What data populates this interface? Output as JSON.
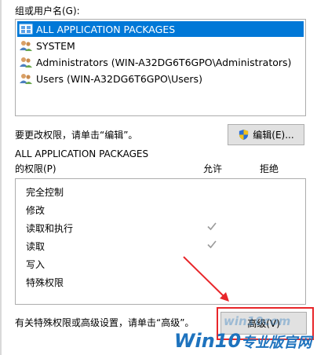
{
  "groups_label": "组或用户名(G):",
  "users": [
    {
      "label": "ALL APPLICATION PACKAGES",
      "icon": "app-packages-icon",
      "selected": true
    },
    {
      "label": "SYSTEM",
      "icon": "users-group-icon",
      "selected": false
    },
    {
      "label": "Administrators (WIN-A32DG6T6GPO\\Administrators)",
      "icon": "users-group-icon",
      "selected": false
    },
    {
      "label": "Users (WIN-A32DG6T6GPO\\Users)",
      "icon": "users-group-icon",
      "selected": false
    }
  ],
  "change_hint": "要更改权限，请单击“编辑”。",
  "edit_button": "编辑(E)...",
  "perm_owner": "ALL APPLICATION PACKAGES",
  "perm_label": "的权限(P)",
  "col_allow": "允许",
  "col_deny": "拒绝",
  "permissions": [
    {
      "name": "完全控制",
      "allow": false,
      "deny": false
    },
    {
      "name": "修改",
      "allow": false,
      "deny": false
    },
    {
      "name": "读取和执行",
      "allow": true,
      "deny": false
    },
    {
      "name": "读取",
      "allow": true,
      "deny": false
    },
    {
      "name": "写入",
      "allow": false,
      "deny": false
    },
    {
      "name": "特殊权限",
      "allow": false,
      "deny": false
    }
  ],
  "advanced_hint": "有关特殊权限或高级设置，请单击“高级”。",
  "advanced_button": "高级(V)",
  "watermark_main": "Win10",
  "watermark_sub": "专业版官网",
  "watermark_url": "win10com",
  "colors": {
    "selection": "#0078d7",
    "annotation_red": "#e8262a",
    "check_gray": "#9a9a9a",
    "watermark_blue": "#1e73be"
  }
}
